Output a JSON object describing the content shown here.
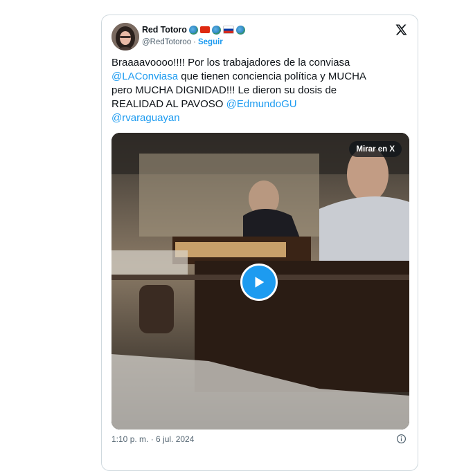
{
  "tweet": {
    "display_name": "Red Totoro",
    "handle": "@RedTotoroo",
    "separator": "·",
    "follow_label": "Seguir",
    "text_lines": [
      [
        {
          "t": "Braaaavoooo!!!! Por los trabajadores de la conviasa",
          "m": false
        }
      ],
      [
        {
          "t": "@LAConviasa",
          "m": true
        },
        {
          "t": " que tienen conciencia política y MUCHA",
          "m": false
        }
      ],
      [
        {
          "t": "pero MUCHA DIGNIDAD!!! Le dieron su dosis de",
          "m": false
        }
      ],
      [
        {
          "t": "REALIDAD AL PAVOSO ",
          "m": false
        },
        {
          "t": "@EdmundoGU",
          "m": true
        }
      ],
      [
        {
          "t": "@rvaraguayan",
          "m": true
        }
      ]
    ],
    "timestamp": "1:10 p. m. · 6 jul. 2024"
  },
  "media": {
    "watch_label": "Mirar en X"
  },
  "icons": {
    "brand": "x-logo-icon",
    "play": "play-icon",
    "info": "info-icon"
  },
  "colors": {
    "accent": "#1d9bf0",
    "muted": "#536471",
    "text": "#0f1419",
    "border": "#cfd9de"
  }
}
